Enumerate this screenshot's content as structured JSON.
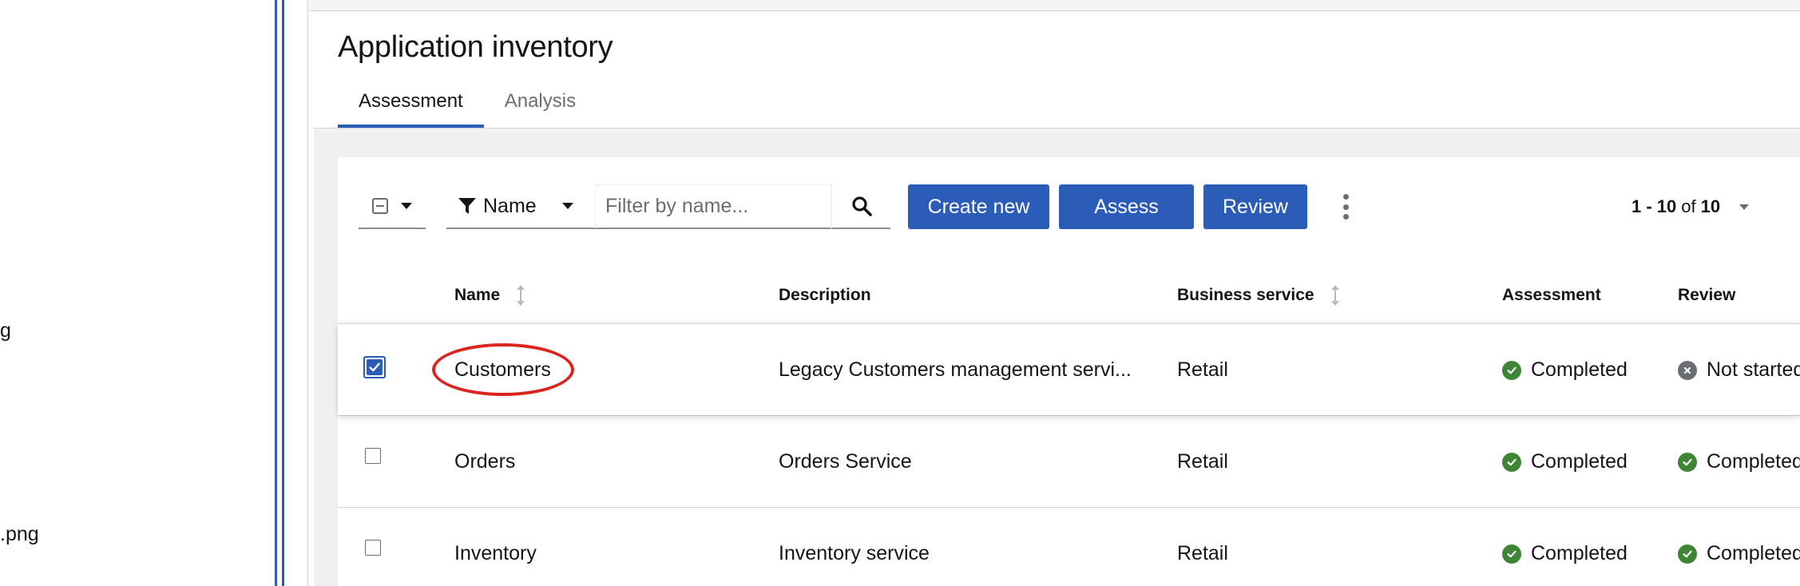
{
  "left_panel": {
    "fragments": [
      "g",
      ".png"
    ]
  },
  "page": {
    "title": "Application inventory"
  },
  "tabs": [
    {
      "label": "Assessment",
      "active": true
    },
    {
      "label": "Analysis",
      "active": false
    }
  ],
  "toolbar": {
    "filter_label": "Name",
    "search_placeholder": "Filter by name...",
    "create_label": "Create new",
    "assess_label": "Assess",
    "review_label": "Review"
  },
  "pagination": {
    "range": "1 - 10",
    "of": "of",
    "total": "10"
  },
  "table": {
    "columns": [
      "Name",
      "Description",
      "Business service",
      "Assessment",
      "Review"
    ],
    "rows": [
      {
        "name": "Customers",
        "description": "Legacy Customers management servi...",
        "business_service": "Retail",
        "assessment": "Completed",
        "review": "Not started",
        "selected": true
      },
      {
        "name": "Orders",
        "description": "Orders Service",
        "business_service": "Retail",
        "assessment": "Completed",
        "review": "Completed",
        "selected": false
      },
      {
        "name": "Inventory",
        "description": "Inventory service",
        "business_service": "Retail",
        "assessment": "Completed",
        "review": "Completed",
        "selected": false
      }
    ]
  },
  "colors": {
    "primary": "#2b5cb8",
    "success": "#3e8635",
    "neutral": "#6a6e73",
    "highlight": "#d9251d"
  },
  "icons": {
    "filter": "filter-icon",
    "search": "search-icon",
    "kebab": "kebab-icon",
    "sort": "sort-icon",
    "status_completed": "check-circle-icon",
    "status_not_started": "times-circle-icon"
  }
}
